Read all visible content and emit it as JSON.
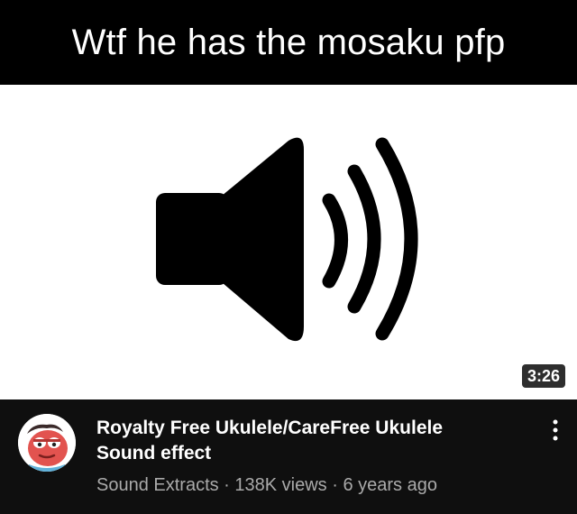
{
  "caption": {
    "text": "Wtf he has the mosaku pfp"
  },
  "video": {
    "duration": "3:26",
    "title_line1": "Royalty Free Ukulele/CareFree Ukulele",
    "title_line2": "Sound effect",
    "channel": "Sound Extracts",
    "separator": " · ",
    "views": "138K views",
    "age": "6 years ago"
  },
  "icons": {
    "thumbnail": "speaker-volume-icon",
    "avatar": "mosaku-character-avatar",
    "menu": "more-vertical-icon"
  },
  "colors": {
    "caption_bg": "#000000",
    "meta_bg": "#0f0f0f",
    "title": "#ffffff",
    "subtext": "#aaaaaa",
    "avatar_face": "#e2534f"
  }
}
